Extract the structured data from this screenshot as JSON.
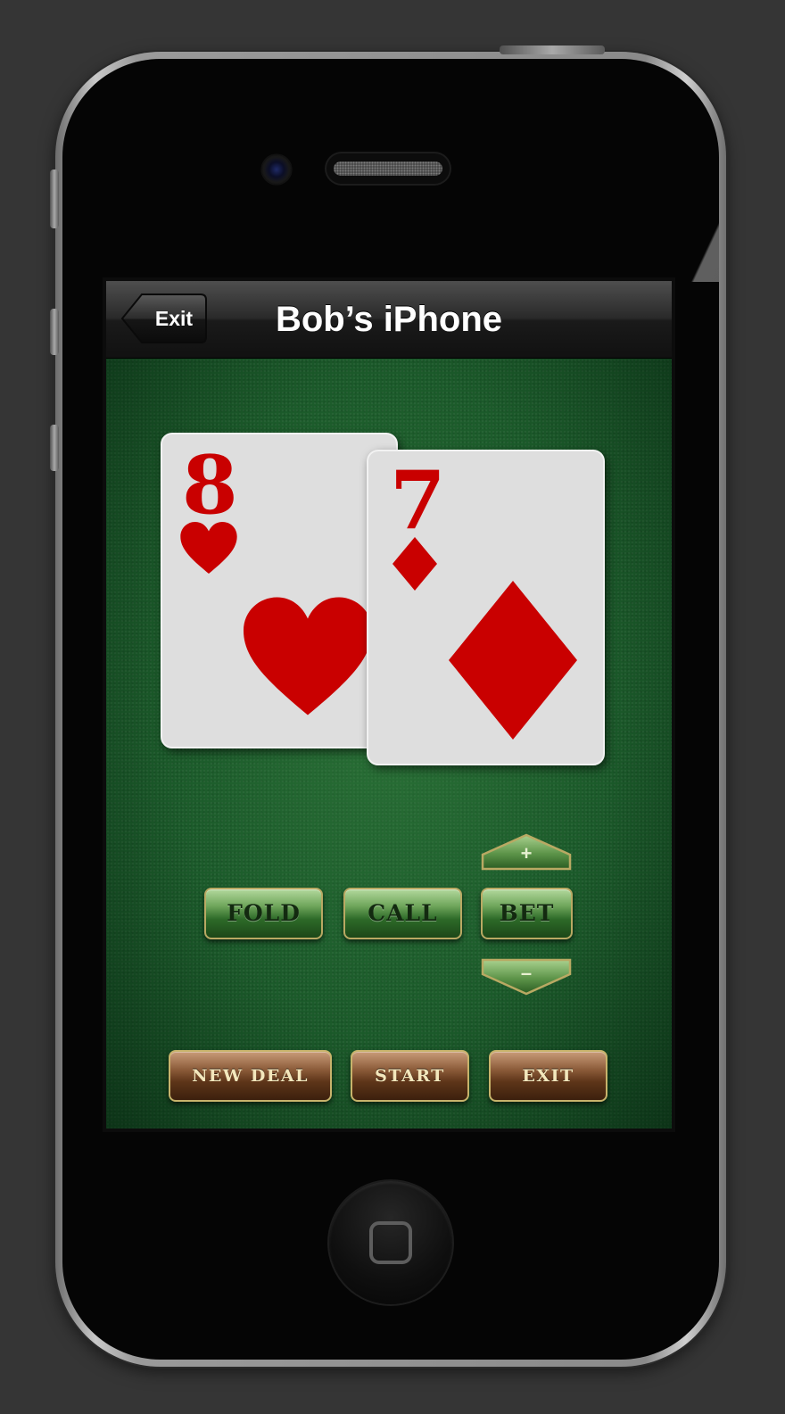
{
  "navbar": {
    "back_label": "Exit",
    "title": "Bob’s iPhone"
  },
  "hand": [
    {
      "rank": "8",
      "suit": "hearts",
      "color": "#c90000",
      "icon": "heart-icon"
    },
    {
      "rank": "7",
      "suit": "diamonds",
      "color": "#c90000",
      "icon": "diamond-icon"
    }
  ],
  "bet_controls": {
    "increase_label": "+",
    "decrease_label": "–"
  },
  "actions": {
    "fold_label": "FOLD",
    "call_label": "CALL",
    "bet_label": "BET"
  },
  "game_menu": {
    "new_deal_label": "NEW DEAL",
    "start_label": "START",
    "exit_label": "EXIT"
  },
  "colors": {
    "felt": "#1b5a2a",
    "card_red": "#c90000",
    "button_green": "#2d6a28",
    "button_brown": "#5e3519",
    "button_border_gold": "#b9a963"
  }
}
